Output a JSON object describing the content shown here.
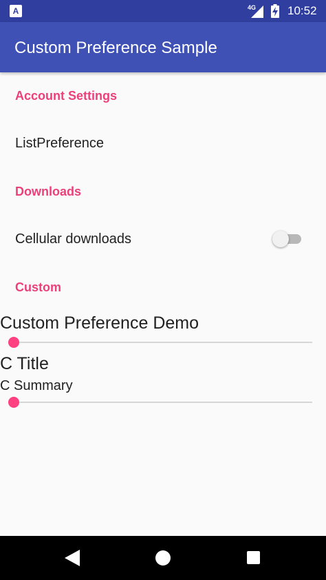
{
  "status_bar": {
    "app_icon_letter": "A",
    "network_type": "4G",
    "time": "10:52"
  },
  "app_bar": {
    "title": "Custom Preference Sample"
  },
  "preferences": {
    "account_category": "Account Settings",
    "list_preference_title": "ListPreference",
    "downloads_category": "Downloads",
    "cellular_downloads_title": "Cellular downloads",
    "cellular_downloads_enabled": false,
    "custom_category": "Custom",
    "custom_demo": {
      "title": "Custom Preference Demo",
      "seek_fraction": 0.0
    },
    "c_pref": {
      "title": "C Title",
      "summary": "C Summary",
      "seek_fraction": 0.0
    }
  },
  "colors": {
    "status_bar": "#303f9f",
    "primary": "#3f51b5",
    "accent": "#ff4081",
    "category_text": "#ec407a"
  },
  "nav_bar": {
    "back_icon": "triangle-back-icon",
    "home_icon": "circle-home-icon",
    "recents_icon": "square-recents-icon"
  }
}
